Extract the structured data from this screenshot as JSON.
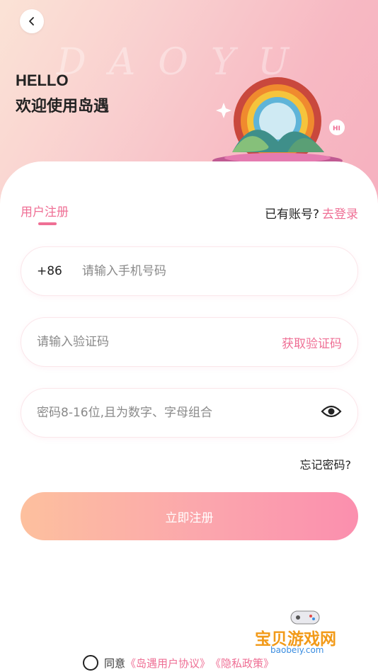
{
  "header": {
    "watermark": "DAOYU",
    "hello": "HELLO",
    "welcome": "欢迎使用岛遇"
  },
  "tabs": {
    "register": "用户注册",
    "has_account": "已有账号?",
    "login_link": "去登录"
  },
  "form": {
    "phone_prefix": "+86",
    "phone_placeholder": "请输入手机号码",
    "code_placeholder": "请输入验证码",
    "get_code": "获取验证码",
    "password_placeholder": "密码8-16位,且为数字、字母组合",
    "forgot": "忘记密码?",
    "submit": "立即注册"
  },
  "agreement": {
    "prefix": "同意",
    "user_agreement": "《岛遇用户协议》",
    "privacy_policy": "《隐私政策》"
  },
  "brand_overlay": {
    "title": "宝贝游戏网",
    "url": "baobeiy.com"
  },
  "colors": {
    "accent": "#ef6f95",
    "button_start": "#fdc09e",
    "button_end": "#fb8fae"
  },
  "icons": [
    "back-arrow-icon",
    "eye-icon",
    "rainbow-illustration",
    "sparkle-icon",
    "hi-bubble-icon"
  ]
}
